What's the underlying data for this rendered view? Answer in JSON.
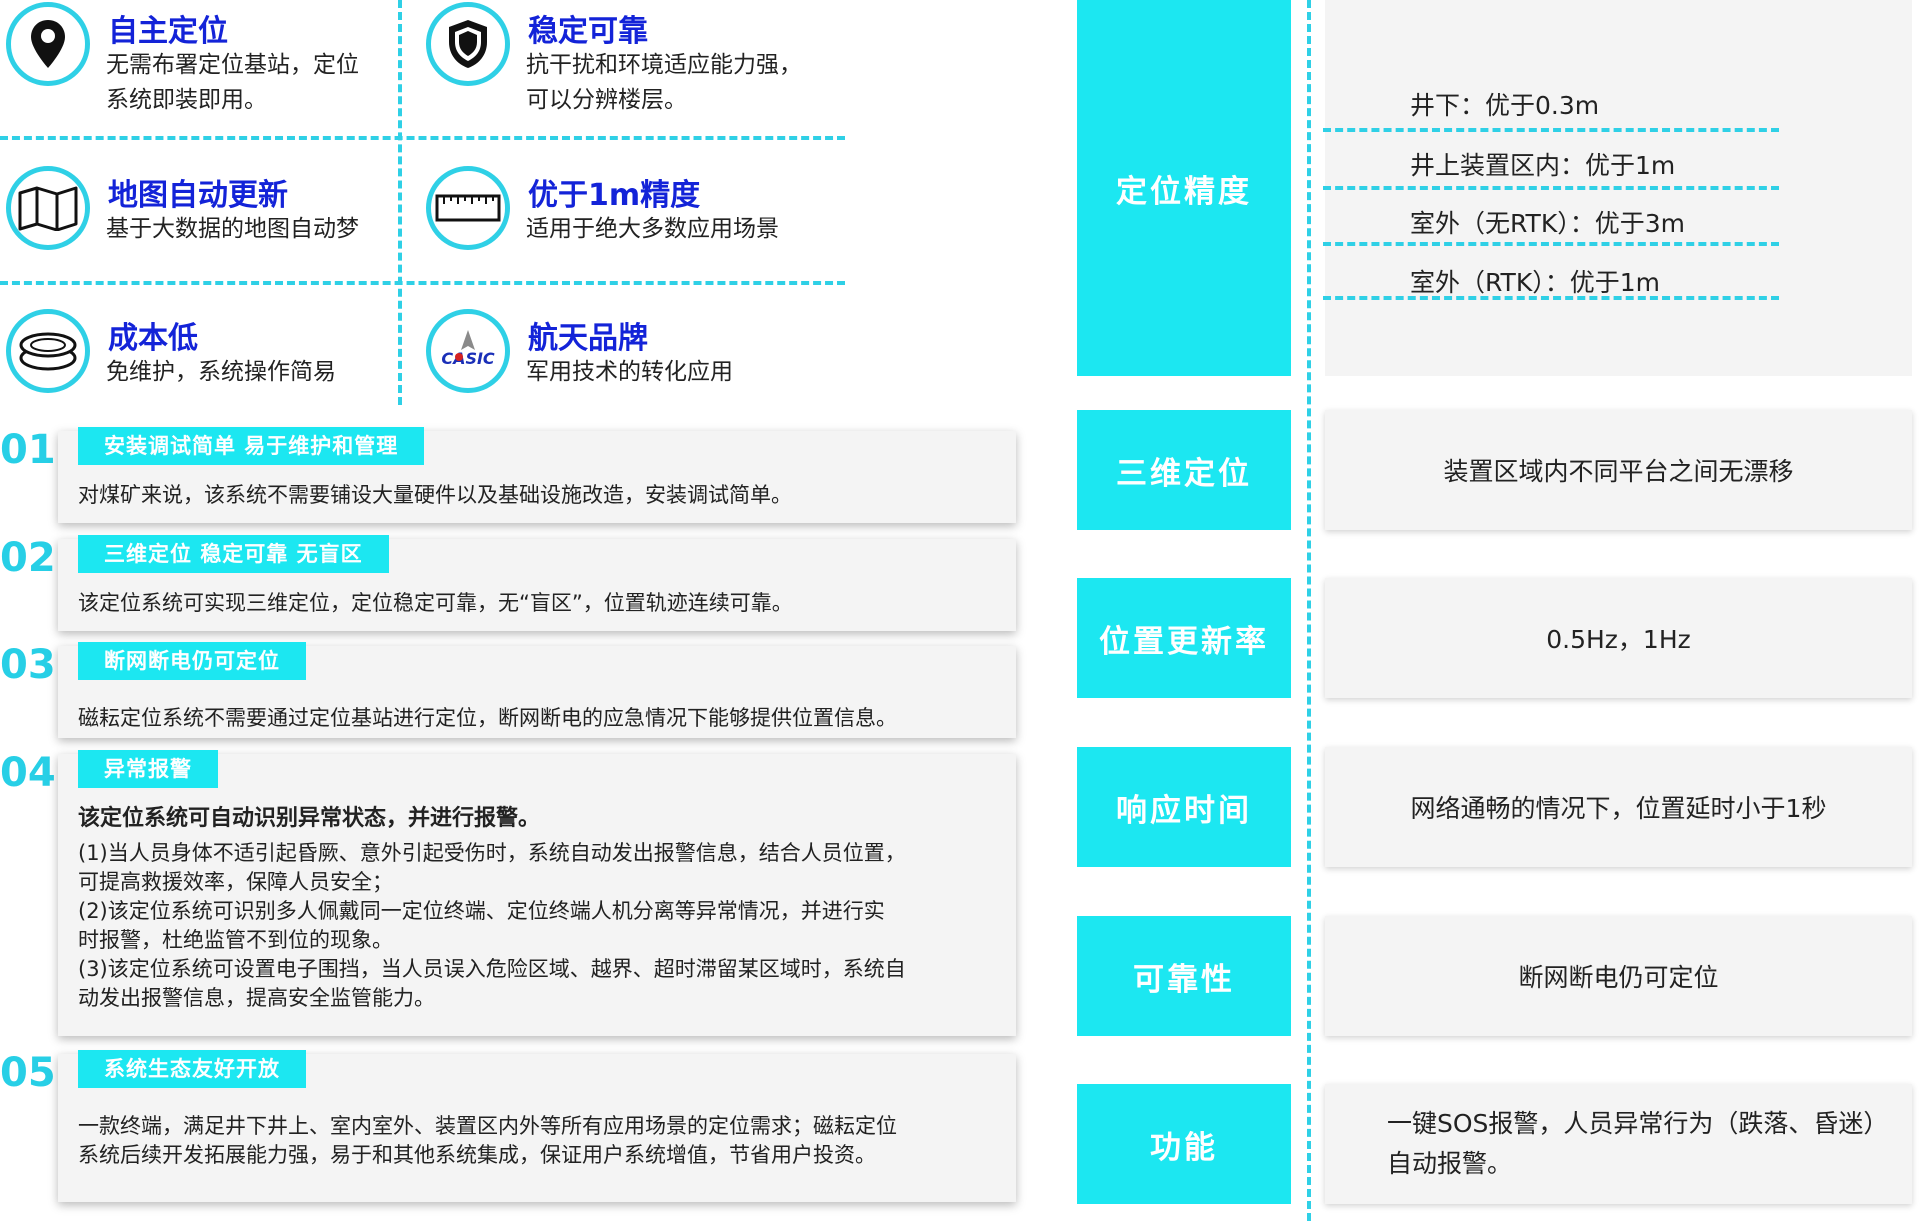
{
  "features": [
    {
      "title": "自主定位",
      "desc": [
        "无需布署定位基站，定位",
        "系统即装即用。"
      ],
      "icon": "location-pin-icon"
    },
    {
      "title": "稳定可靠",
      "desc": [
        "抗干扰和环境适应能力强，",
        "可以分辨楼层。"
      ],
      "icon": "shield-icon"
    },
    {
      "title": "地图自动更新",
      "desc": [
        "基于大数据的地图自动梦"
      ],
      "icon": "map-icon"
    },
    {
      "title": "优于1m精度",
      "desc": [
        "适用于绝大多数应用场景"
      ],
      "icon": "ruler-icon"
    },
    {
      "title": "成本低",
      "desc": [
        "免维护，系统操作简易"
      ],
      "icon": "coins-icon"
    },
    {
      "title": "航天品牌",
      "desc": [
        "军用技术的转化应用"
      ],
      "icon": "casic-logo-icon",
      "logo_text": "CASIC"
    }
  ],
  "advantages": [
    {
      "num": "01",
      "tag": "安装调试简单 易于维护和管理",
      "lead": "",
      "lines": [
        "对煤矿来说，该系统不需要铺设大量硬件以及基础设施改造，安装调试简单。"
      ]
    },
    {
      "num": "02",
      "tag": "三维定位 稳定可靠 无盲区",
      "lead": "",
      "lines": [
        "该定位系统可实现三维定位，定位稳定可靠，无“盲区”，位置轨迹连续可靠。"
      ]
    },
    {
      "num": "03",
      "tag": "断网断电仍可定位",
      "lead": "",
      "lines": [
        "磁耘定位系统不需要通过定位基站进行定位，断网断电的应急情况下能够提供位置信息。"
      ]
    },
    {
      "num": "04",
      "tag": "异常报警",
      "lead": "该定位系统可自动识别异常状态，并进行报警。",
      "lines": [
        "(1)当人员身体不适引起昏厥、意外引起受伤时，系统自动发出报警信息，结合人员位置，",
        "可提高救援效率，保障人员安全；",
        "(2)该定位系统可识别多人佩戴同一定位终端、定位终端人机分离等异常情况，并进行实",
        "时报警，杜绝监管不到位的现象。",
        "(3)该定位系统可设置电子围挡，当人员误入危险区域、越界、超时滞留某区域时，系统自",
        "动发出报警信息，提高安全监管能力。"
      ]
    },
    {
      "num": "05",
      "tag": "系统生态友好开放",
      "lead": "",
      "lines": [
        "一款终端，满足井下井上、室内室外、装置区内外等所有应用场景的定位需求；磁耘定位",
        "系统后续开发拓展能力强，易于和其他系统集成，保证用户系统增值，节省用户投资。"
      ]
    }
  ],
  "specs": {
    "precision": {
      "label": "定位精度",
      "items": [
        "井下：优于0.3m",
        "井上装置区内：优于1m",
        "室外（无RTK）：优于3m",
        "室外（RTK）：优于1m"
      ]
    },
    "rows": [
      {
        "label": "三维定位",
        "value": [
          "装置区域内不同平台之间无漂移"
        ]
      },
      {
        "label": "位置更新率",
        "value": [
          "0.5Hz，1Hz"
        ]
      },
      {
        "label": "响应时间",
        "value": [
          "网络通畅的情况下，位置延时小于1秒"
        ]
      },
      {
        "label": "可靠性",
        "value": [
          "断网断电仍可定位"
        ]
      },
      {
        "label": "功能",
        "value": [
          "一键SOS报警，人员异常行为（跌落、昏迷）",
          "自动报警。"
        ]
      }
    ]
  },
  "colors": {
    "accent": "#1ce7f1",
    "title_blue": "#1323d8",
    "num_cyan": "#27cfe6",
    "card_bg": "#f4f4f4"
  }
}
